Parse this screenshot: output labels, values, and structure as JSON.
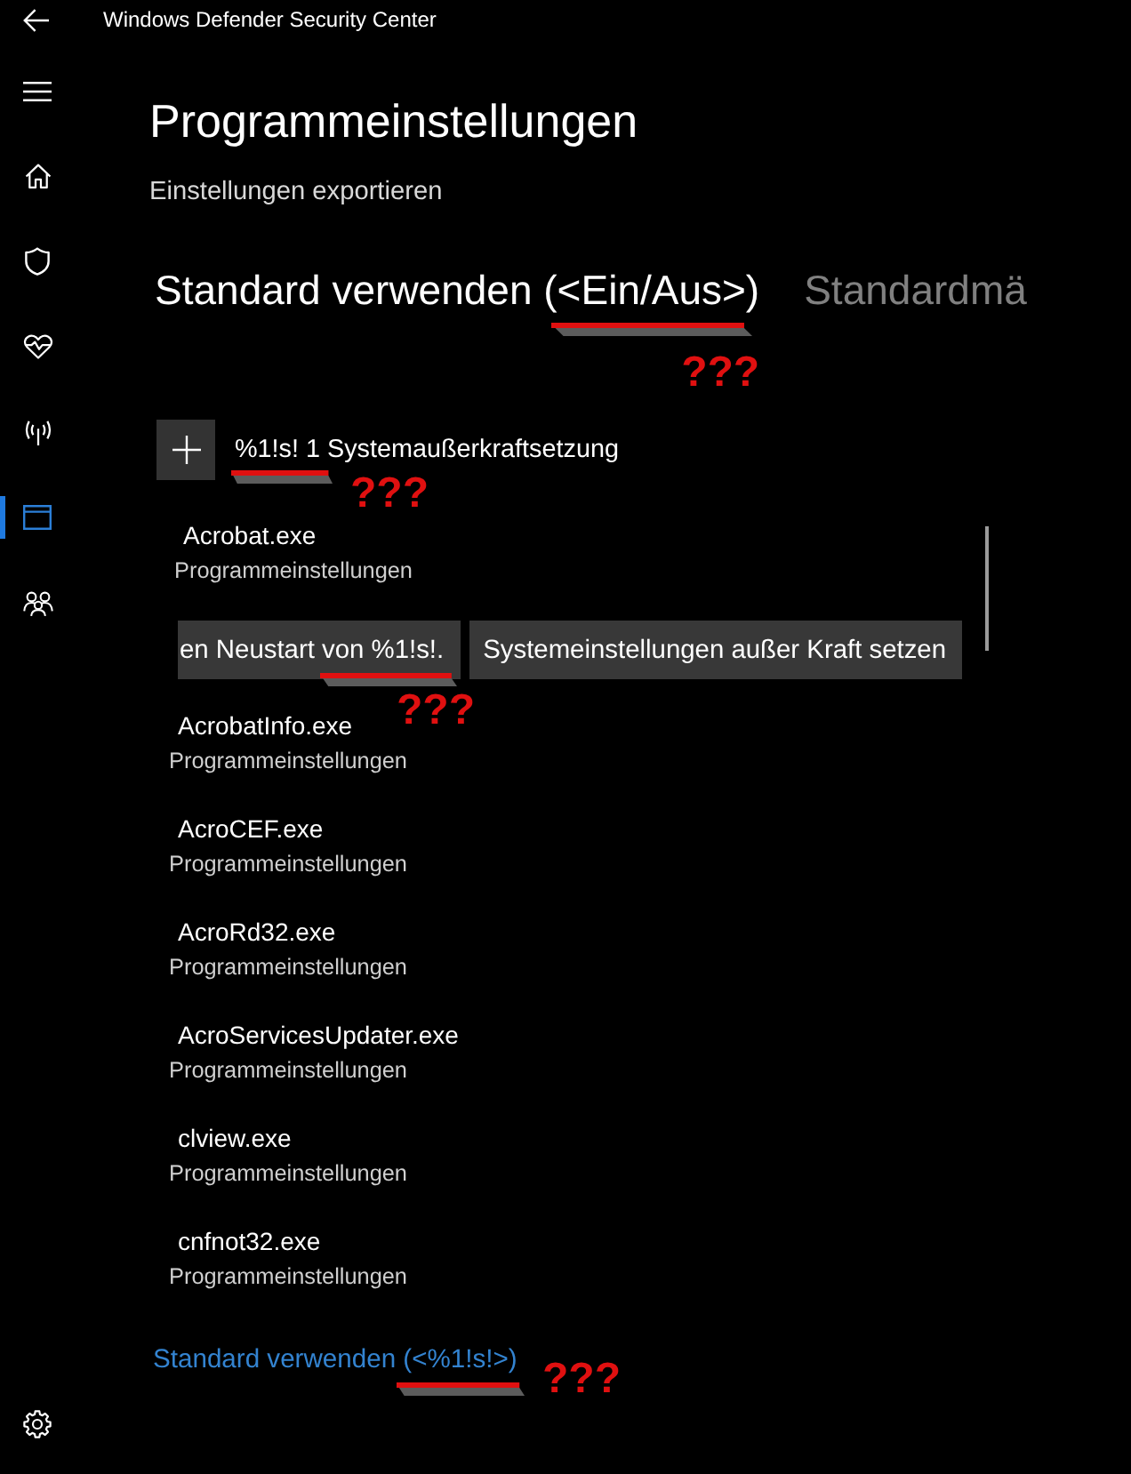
{
  "window": {
    "title": "Windows Defender Security Center"
  },
  "sidebar": {
    "items": [
      {
        "kind": "menu",
        "selected": false
      },
      {
        "kind": "home",
        "selected": false
      },
      {
        "kind": "shield",
        "selected": false
      },
      {
        "kind": "health",
        "selected": false
      },
      {
        "kind": "network",
        "selected": false
      },
      {
        "kind": "app",
        "selected": true
      },
      {
        "kind": "family",
        "selected": false
      },
      {
        "kind": "settings",
        "selected": false
      }
    ]
  },
  "page": {
    "title": "Programmeinstellungen",
    "export_link": "Einstellungen exportieren"
  },
  "tabs": [
    {
      "label": "Standard verwenden (<Ein/Aus>)",
      "selected": true,
      "annotation": "???"
    },
    {
      "label": "Standardmä",
      "selected": false
    }
  ],
  "add_override": {
    "label": "%1!s! 1 Systemaußerkraftsetzung",
    "annotation": "???"
  },
  "programs": [
    {
      "name": "Acrobat.exe",
      "subtitle": "Programmeinstellungen",
      "buttons": [
        {
          "label": "en Neustart von %1!s!.",
          "annotation": "???"
        },
        {
          "label": "Systemeinstellungen außer Kraft setzen"
        }
      ]
    },
    {
      "name": "AcrobatInfo.exe",
      "subtitle": "Programmeinstellungen"
    },
    {
      "name": "AcroCEF.exe",
      "subtitle": "Programmeinstellungen"
    },
    {
      "name": "AcroRd32.exe",
      "subtitle": "Programmeinstellungen"
    },
    {
      "name": "AcroServicesUpdater.exe",
      "subtitle": "Programmeinstellungen"
    },
    {
      "name": "clview.exe",
      "subtitle": "Programmeinstellungen"
    },
    {
      "name": "cnfnot32.exe",
      "subtitle": "Programmeinstellungen"
    }
  ],
  "footer_link": {
    "label": "Standard verwenden (<%1!s!>)",
    "annotation": "???"
  }
}
